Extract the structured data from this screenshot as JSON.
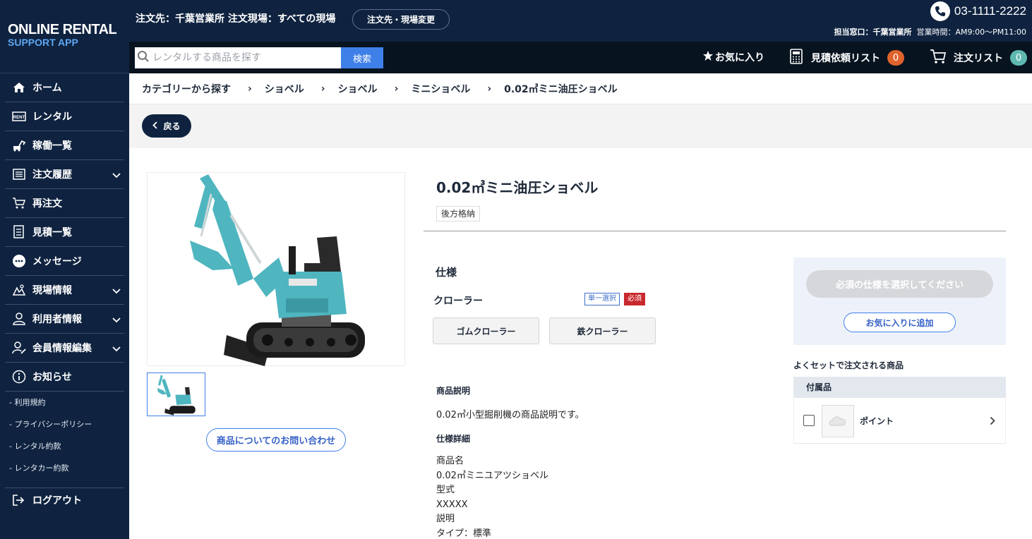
{
  "sidebar": {
    "logo_line1": "ONLINE RENTAL",
    "logo_line2": "SUPPORT APP",
    "items": [
      {
        "label": "ホーム",
        "icon": "home-icon"
      },
      {
        "label": "レンタル",
        "icon": "rent-icon"
      },
      {
        "label": "稼働一覧",
        "icon": "machine-icon"
      },
      {
        "label": "注文履歴",
        "icon": "list-icon",
        "expandable": true
      },
      {
        "label": "再注文",
        "icon": "cart-return-icon"
      },
      {
        "label": "見積一覧",
        "icon": "document-icon"
      },
      {
        "label": "メッセージ",
        "icon": "chat-icon"
      },
      {
        "label": "現場情報",
        "icon": "site-icon",
        "expandable": true
      },
      {
        "label": "利用者情報",
        "icon": "user-icon",
        "expandable": true
      },
      {
        "label": "会員情報編集",
        "icon": "user-edit-icon",
        "expandable": true
      },
      {
        "label": "お知らせ",
        "icon": "info-icon"
      }
    ],
    "sub_links": [
      "利用規約",
      "プライバシーポリシー",
      "レンタル約款",
      "レンタカー約款"
    ],
    "logout": "ログアウト"
  },
  "header": {
    "order_info": "注文先：千葉営業所 注文現場：すべての現場",
    "change_button": "注文先・現場変更",
    "phone": "03-1111-2222",
    "contact_label": "担当窓口：千葉営業所",
    "hours": "営業時間：AM9:00〜PM11:00",
    "search_placeholder": "レンタルする商品を探す",
    "search_button": "検索",
    "favorites": "お気に入り",
    "quote_list": "見積依頼リスト",
    "quote_count": "0",
    "order_list": "注文リスト",
    "order_count": "0",
    "quote_badge_color": "#e0632d",
    "order_badge_color": "#5fb8b0"
  },
  "breadcrumb": [
    "カテゴリーから探す",
    "ショベル",
    "ショベル",
    "ミニショベル",
    "0.02㎥ミニ油圧ショベル"
  ],
  "back_button": "戻る",
  "product": {
    "title": "0.02㎥ミニ油圧ショベル",
    "tag": "後方格納",
    "inquiry_button": "商品についてのお問い合わせ",
    "spec_title": "仕様",
    "option_label": "クローラー",
    "select_badge": "単一選択",
    "required_badge": "必須",
    "options": [
      "ゴムクローラー",
      "鉄クローラー"
    ],
    "description_heading": "商品説明",
    "description": "0.02㎥小型掘削機の商品説明です。",
    "detail_heading": "仕様詳細",
    "details": [
      "商品名",
      "0.02㎥ミニユアツショベル",
      "型式",
      "XXXXX",
      "説明",
      "タイプ：標準"
    ]
  },
  "actions": {
    "required_button": "必須の仕様を選択してください",
    "favorite_button": "お気に入りに追加",
    "set_title": "よくセットで注文される商品",
    "accessory_header": "付属品",
    "accessory_name": "ポイント"
  }
}
